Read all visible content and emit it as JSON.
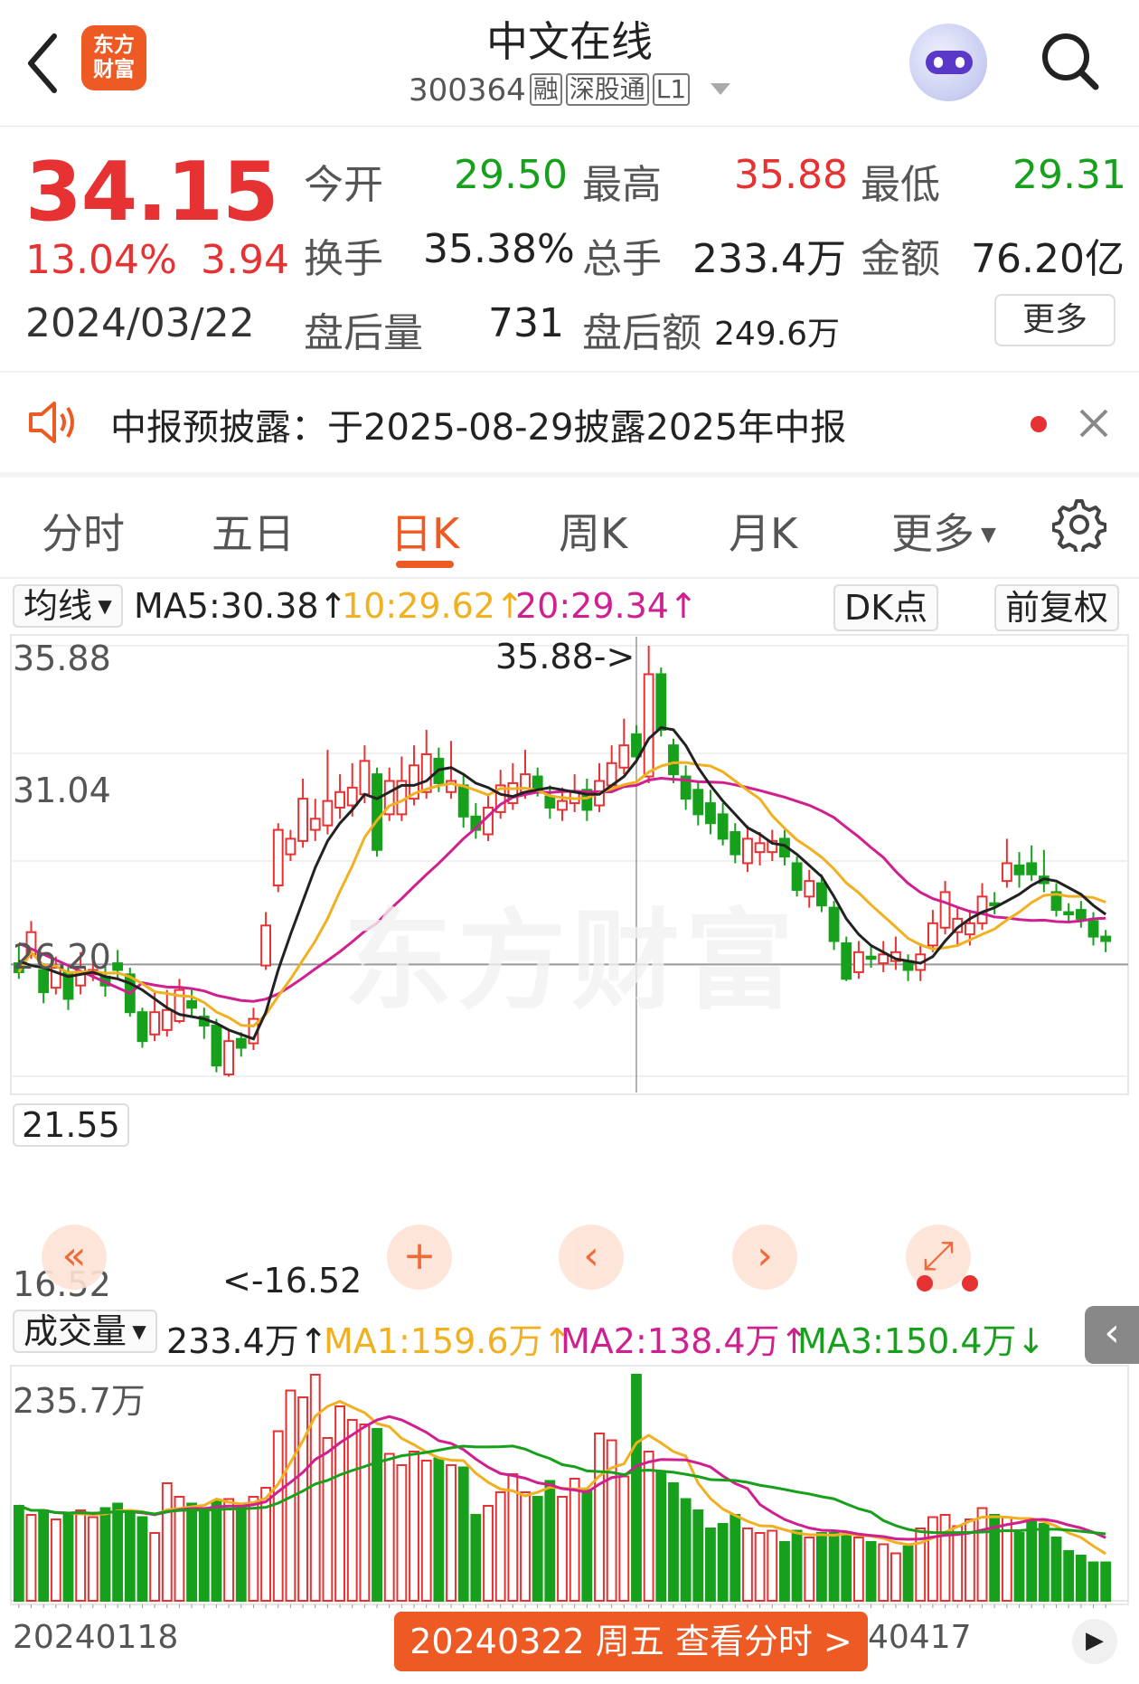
{
  "header": {
    "logo_text": "东方财富",
    "stock_name": "中文在线",
    "stock_code": "300364",
    "tags": [
      "融",
      "深股通",
      "L1"
    ],
    "icons": [
      "back-icon",
      "robot-assistant-icon",
      "search-icon"
    ]
  },
  "quote": {
    "price": "34.15",
    "change_pct": "13.04%",
    "change_amt": "3.94",
    "date": "2024/03/22",
    "open_label": "今开",
    "open": "29.50",
    "high_label": "最高",
    "high": "35.88",
    "low_label": "最低",
    "low": "29.31",
    "turnover_label": "换手",
    "turnover": "35.38%",
    "volume_label": "总手",
    "volume": "233.4万",
    "amount_label": "金额",
    "amount": "76.20亿",
    "after_vol_label": "盘后量",
    "after_vol": "731",
    "after_amt_label": "盘后额",
    "after_amt": "249.6万",
    "more_label": "更多"
  },
  "notice": {
    "text": "中报预披露：于2025-08-29披露2025年中报"
  },
  "tabs": {
    "items": [
      "分时",
      "五日",
      "日K",
      "周K",
      "月K",
      "更多"
    ],
    "active": "日K"
  },
  "ma_bar": {
    "selector": "均线",
    "ma5": "MA5:30.38↑",
    "ma10": "10:29.62↑",
    "ma20": "20:29.34↑",
    "dk_label": "DK点",
    "adjust_label": "前复权"
  },
  "kline": {
    "y_labels": [
      "35.88",
      "31.04",
      "26.20",
      "21.55",
      "16.52"
    ],
    "max_annotation": "35.88->",
    "min_annotation": "<-16.52"
  },
  "vol_bar": {
    "selector": "成交量",
    "vol": "233.4万↑",
    "ma1": "MA1:159.6万↑",
    "ma2": "MA2:138.4万↑",
    "ma3": "MA3:150.4万↓",
    "y_label": "235.7万"
  },
  "x_axis": {
    "left_date": "20240118",
    "right_date": "40417"
  },
  "bottom_button": "20240322 周五 查看分时 >",
  "colors": {
    "up": "#e63232",
    "down": "#16a01c",
    "accent": "#ee5a24",
    "ma5": "#222222",
    "ma10": "#f0b020",
    "ma20": "#d02090"
  },
  "chart_data": {
    "type": "candlestick",
    "candles": [
      {
        "o": 21.6,
        "c": 21.2,
        "h": 22.4,
        "l": 20.9
      },
      {
        "o": 22.0,
        "c": 23.0,
        "h": 23.5,
        "l": 21.8
      },
      {
        "o": 21.3,
        "c": 20.3,
        "h": 21.6,
        "l": 19.8
      },
      {
        "o": 20.5,
        "c": 21.4,
        "h": 21.9,
        "l": 20.2
      },
      {
        "o": 21.2,
        "c": 20.0,
        "h": 21.5,
        "l": 19.5
      },
      {
        "o": 20.6,
        "c": 21.4,
        "h": 22.1,
        "l": 20.2
      },
      {
        "o": 21.1,
        "c": 21.3,
        "h": 21.8,
        "l": 20.8
      },
      {
        "o": 21.0,
        "c": 20.6,
        "h": 21.6,
        "l": 20.1
      },
      {
        "o": 21.6,
        "c": 21.3,
        "h": 22.2,
        "l": 20.9
      },
      {
        "o": 21.1,
        "c": 19.4,
        "h": 21.4,
        "l": 19.2
      },
      {
        "o": 19.4,
        "c": 18.1,
        "h": 19.6,
        "l": 17.8
      },
      {
        "o": 18.4,
        "c": 19.4,
        "h": 20.3,
        "l": 18.1
      },
      {
        "o": 18.6,
        "c": 19.5,
        "h": 20.4,
        "l": 18.3
      },
      {
        "o": 19.0,
        "c": 20.4,
        "h": 20.9,
        "l": 18.9
      },
      {
        "o": 19.9,
        "c": 19.6,
        "h": 20.4,
        "l": 19.2
      },
      {
        "o": 19.2,
        "c": 18.8,
        "h": 19.6,
        "l": 18.2
      },
      {
        "o": 18.8,
        "c": 17.0,
        "h": 19.1,
        "l": 16.7
      },
      {
        "o": 16.6,
        "c": 18.1,
        "h": 18.6,
        "l": 16.5
      },
      {
        "o": 18.2,
        "c": 17.8,
        "h": 18.5,
        "l": 17.4
      },
      {
        "o": 18.0,
        "c": 19.1,
        "h": 19.6,
        "l": 17.7
      },
      {
        "o": 21.5,
        "c": 23.3,
        "h": 23.9,
        "l": 21.3
      },
      {
        "o": 25.1,
        "c": 27.6,
        "h": 27.9,
        "l": 24.8
      },
      {
        "o": 26.5,
        "c": 27.2,
        "h": 27.6,
        "l": 26.2
      },
      {
        "o": 27.1,
        "c": 29.0,
        "h": 29.9,
        "l": 26.8
      },
      {
        "o": 27.6,
        "c": 28.1,
        "h": 29.0,
        "l": 27.1
      },
      {
        "o": 27.8,
        "c": 28.9,
        "h": 31.2,
        "l": 27.4
      },
      {
        "o": 28.6,
        "c": 29.3,
        "h": 30.1,
        "l": 28.1
      },
      {
        "o": 28.7,
        "c": 29.5,
        "h": 30.6,
        "l": 28.2
      },
      {
        "o": 29.2,
        "c": 30.7,
        "h": 31.4,
        "l": 28.8
      },
      {
        "o": 30.1,
        "c": 26.7,
        "h": 30.4,
        "l": 26.4
      },
      {
        "o": 28.3,
        "c": 29.8,
        "h": 30.4,
        "l": 28.0
      },
      {
        "o": 28.3,
        "c": 29.8,
        "h": 30.9,
        "l": 28.0
      },
      {
        "o": 29.0,
        "c": 30.5,
        "h": 31.4,
        "l": 28.7
      },
      {
        "o": 29.3,
        "c": 31.0,
        "h": 32.1,
        "l": 29.0
      },
      {
        "o": 30.8,
        "c": 29.7,
        "h": 31.3,
        "l": 29.3
      },
      {
        "o": 29.3,
        "c": 29.8,
        "h": 31.6,
        "l": 29.0
      },
      {
        "o": 29.6,
        "c": 28.2,
        "h": 30.1,
        "l": 27.7
      },
      {
        "o": 28.2,
        "c": 27.6,
        "h": 28.8,
        "l": 27.2
      },
      {
        "o": 27.4,
        "c": 28.6,
        "h": 29.2,
        "l": 27.1
      },
      {
        "o": 28.4,
        "c": 29.6,
        "h": 30.3,
        "l": 28.1
      },
      {
        "o": 28.8,
        "c": 29.7,
        "h": 30.6,
        "l": 28.5
      },
      {
        "o": 29.3,
        "c": 30.1,
        "h": 31.2,
        "l": 29.0
      },
      {
        "o": 30.0,
        "c": 29.4,
        "h": 30.4,
        "l": 29.1
      },
      {
        "o": 29.1,
        "c": 28.6,
        "h": 29.6,
        "l": 28.1
      },
      {
        "o": 28.5,
        "c": 28.9,
        "h": 29.5,
        "l": 28.0
      },
      {
        "o": 28.8,
        "c": 29.3,
        "h": 30.1,
        "l": 28.4
      },
      {
        "o": 29.4,
        "c": 28.5,
        "h": 29.9,
        "l": 28.0
      },
      {
        "o": 28.7,
        "c": 29.8,
        "h": 30.6,
        "l": 28.4
      },
      {
        "o": 29.6,
        "c": 30.6,
        "h": 31.4,
        "l": 29.4
      },
      {
        "o": 30.4,
        "c": 31.4,
        "h": 32.6,
        "l": 30.1
      },
      {
        "o": 31.9,
        "c": 30.9,
        "h": 32.3,
        "l": 30.6
      },
      {
        "o": 30.0,
        "c": 34.6,
        "h": 35.88,
        "l": 29.7
      },
      {
        "o": 34.6,
        "c": 32.1,
        "h": 34.9,
        "l": 31.8
      },
      {
        "o": 31.4,
        "c": 30.1,
        "h": 31.7,
        "l": 29.7
      },
      {
        "o": 30.0,
        "c": 29.0,
        "h": 30.5,
        "l": 28.5
      },
      {
        "o": 29.4,
        "c": 28.3,
        "h": 29.8,
        "l": 27.8
      },
      {
        "o": 28.8,
        "c": 27.9,
        "h": 29.4,
        "l": 27.4
      },
      {
        "o": 28.3,
        "c": 27.2,
        "h": 28.8,
        "l": 26.9
      },
      {
        "o": 27.5,
        "c": 26.5,
        "h": 27.9,
        "l": 26.1
      },
      {
        "o": 26.1,
        "c": 27.2,
        "h": 27.8,
        "l": 25.7
      },
      {
        "o": 26.6,
        "c": 27.0,
        "h": 27.5,
        "l": 26.0
      },
      {
        "o": 26.6,
        "c": 27.1,
        "h": 27.6,
        "l": 26.2
      },
      {
        "o": 27.2,
        "c": 26.4,
        "h": 27.6,
        "l": 26.0
      },
      {
        "o": 26.1,
        "c": 24.9,
        "h": 26.4,
        "l": 24.6
      },
      {
        "o": 24.6,
        "c": 25.3,
        "h": 25.8,
        "l": 24.1
      },
      {
        "o": 25.2,
        "c": 24.2,
        "h": 25.6,
        "l": 23.9
      },
      {
        "o": 24.1,
        "c": 22.6,
        "h": 24.4,
        "l": 22.2
      },
      {
        "o": 22.5,
        "c": 20.9,
        "h": 22.8,
        "l": 20.8
      },
      {
        "o": 21.2,
        "c": 22.1,
        "h": 22.6,
        "l": 20.9
      },
      {
        "o": 21.9,
        "c": 21.8,
        "h": 22.4,
        "l": 21.4
      },
      {
        "o": 21.6,
        "c": 22.0,
        "h": 22.6,
        "l": 21.2
      },
      {
        "o": 21.7,
        "c": 22.1,
        "h": 22.8,
        "l": 21.3
      },
      {
        "o": 21.7,
        "c": 21.3,
        "h": 22.0,
        "l": 20.8
      },
      {
        "o": 21.3,
        "c": 22.0,
        "h": 22.5,
        "l": 20.8
      },
      {
        "o": 22.4,
        "c": 23.4,
        "h": 24.0,
        "l": 22.1
      },
      {
        "o": 23.2,
        "c": 24.8,
        "h": 25.3,
        "l": 22.9
      },
      {
        "o": 23.0,
        "c": 23.6,
        "h": 24.1,
        "l": 22.4
      },
      {
        "o": 22.9,
        "c": 23.4,
        "h": 24.0,
        "l": 22.4
      },
      {
        "o": 23.4,
        "c": 24.6,
        "h": 25.2,
        "l": 23.1
      },
      {
        "o": 24.3,
        "c": 24.2,
        "h": 24.8,
        "l": 23.8
      },
      {
        "o": 25.3,
        "c": 26.1,
        "h": 27.2,
        "l": 25.0
      },
      {
        "o": 26.0,
        "c": 25.6,
        "h": 26.6,
        "l": 25.0
      },
      {
        "o": 26.1,
        "c": 25.6,
        "h": 26.9,
        "l": 25.3
      },
      {
        "o": 25.5,
        "c": 25.2,
        "h": 26.7,
        "l": 24.8
      },
      {
        "o": 24.8,
        "c": 24.0,
        "h": 25.2,
        "l": 23.7
      },
      {
        "o": 23.9,
        "c": 23.8,
        "h": 24.3,
        "l": 23.4
      },
      {
        "o": 24.0,
        "c": 23.6,
        "h": 24.4,
        "l": 23.2
      },
      {
        "o": 23.5,
        "c": 22.8,
        "h": 23.9,
        "l": 22.4
      },
      {
        "o": 22.8,
        "c": 22.6,
        "h": 23.1,
        "l": 22.1
      }
    ],
    "ma5": [
      21.7,
      21.5,
      21.4,
      21.2,
      21.0,
      21.1,
      21.2,
      21.0,
      20.9,
      20.7,
      20.4,
      20.0,
      19.6,
      19.3,
      19.2,
      19.1,
      18.9,
      18.6,
      18.4,
      18.2,
      19.4,
      21.3,
      22.9,
      24.4,
      25.9,
      27.1,
      27.9,
      28.5,
      29.2,
      29.0,
      29.3,
      29.6,
      29.6,
      29.8,
      30.3,
      30.4,
      30.1,
      29.7,
      29.5,
      29.2,
      29.1,
      29.3,
      29.4,
      29.5,
      29.4,
      29.3,
      29.2,
      29.2,
      29.6,
      30.0,
      30.7,
      31.7,
      32.2,
      32.1,
      31.4,
      30.4,
      29.6,
      28.9,
      28.3,
      27.7,
      27.4,
      27.0,
      26.9,
      26.5,
      26.0,
      25.5,
      24.6,
      23.6,
      22.9,
      22.4,
      22.1,
      21.8,
      21.7,
      21.6,
      21.9,
      22.6,
      23.2,
      23.6,
      23.9,
      24.1,
      24.4,
      24.7,
      25.1,
      25.4,
      25.3,
      25.0,
      24.7,
      24.2,
      23.8
    ]
  }
}
